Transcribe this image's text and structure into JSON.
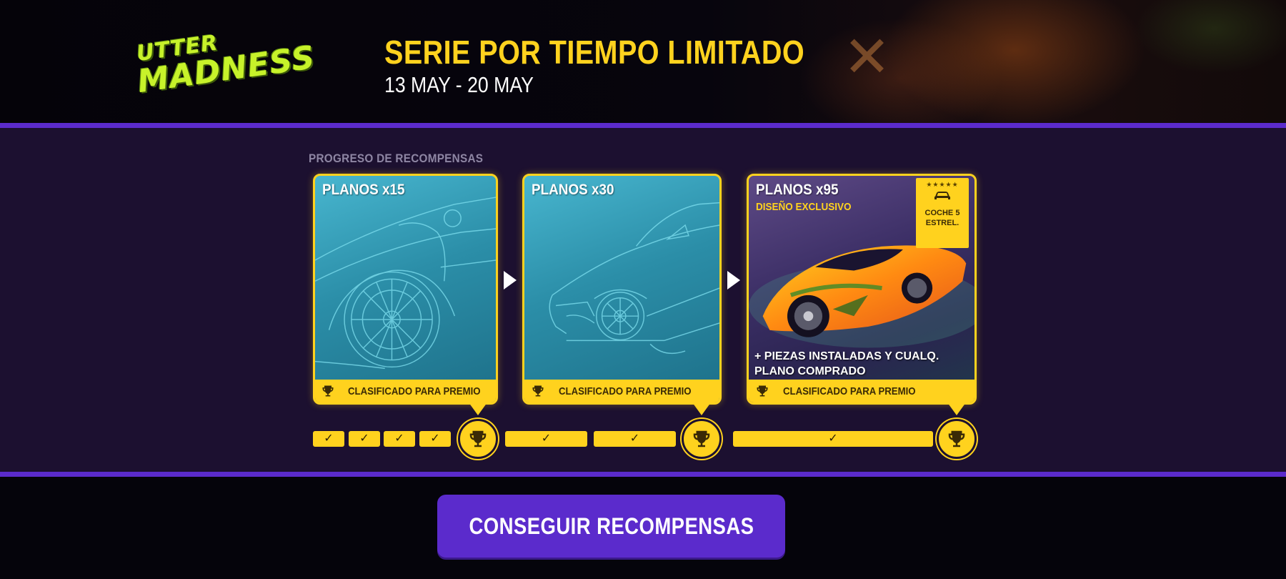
{
  "logo": {
    "line1": "UTTER",
    "line2": "MADNESS",
    "color": "#c7f22a"
  },
  "header": {
    "title": "SERIE POR TIEMPO LIMITADO",
    "dates": "13 MAY - 20 MAY",
    "title_color": "#ffd21e"
  },
  "progress": {
    "label": "PROGRESO DE RECOMPENSAS"
  },
  "rewards": [
    {
      "title": "PLANOS x15",
      "footer": "CLASIFICADO PARA PREMIO",
      "art": "wheel-blueprint"
    },
    {
      "title": "PLANOS x30",
      "footer": "CLASIFICADO PARA PREMIO",
      "art": "car-front-blueprint"
    },
    {
      "title": "PLANOS x95",
      "subtitle": "DISEÑO EXCLUSIVO",
      "extra": "+ PIEZAS INSTALADAS Y CUALQ. PLANO COMPRADO",
      "footer": "CLASIFICADO PARA PREMIO",
      "badge": "COCHE 5 ESTREL.",
      "badge_stars": "★★★★★",
      "art": "orange-sports-car"
    }
  ],
  "progress_track": {
    "check_glyph": "✓",
    "segments_completed": 7,
    "milestones_reached": 3,
    "icon": "trophy-icon"
  },
  "cta": {
    "label": "CONSEGUIR RECOMPENSAS",
    "color": "#5b2bcc"
  }
}
